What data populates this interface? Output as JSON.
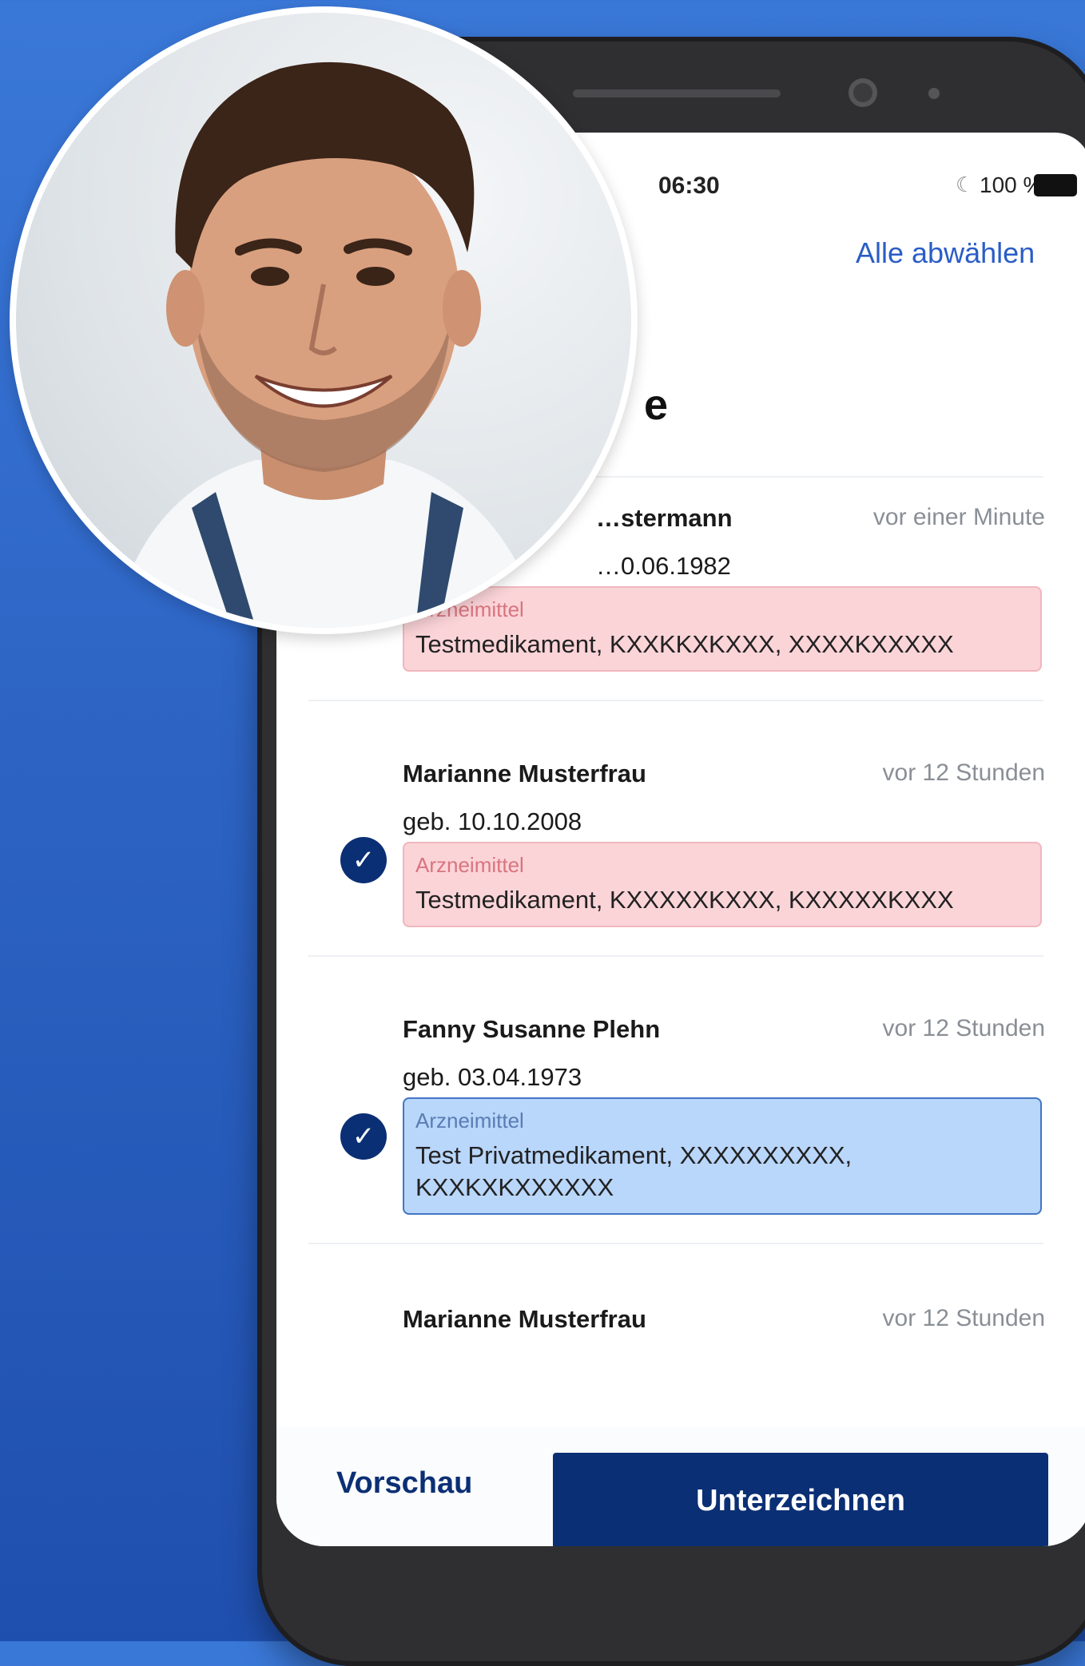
{
  "status": {
    "time": "06:30",
    "battery": "100 %"
  },
  "header": {
    "deselect_all": "Alle abwählen",
    "title_fragment": "e"
  },
  "items": [
    {
      "name": "…stermann",
      "time_ago": "vor einer Minute",
      "birth": "…0.06.1982",
      "med_label": "Arzneimittel",
      "med_value": "Testmedikament, KXXKKXKXXX, XXXXKXXXXX",
      "type": "red",
      "checked": true
    },
    {
      "name": "Marianne Musterfrau",
      "time_ago": "vor 12 Stunden",
      "birth": "geb. 10.10.2008",
      "med_label": "Arzneimittel",
      "med_value": "Testmedikament, KXXXXXKXXX, KXXXXXKXXX",
      "type": "red",
      "checked": true
    },
    {
      "name": "Fanny Susanne Plehn",
      "time_ago": "vor 12 Stunden",
      "birth": "geb. 03.04.1973",
      "med_label": "Arzneimittel",
      "med_value": "Test Privatmedikament, XXXXXXXXXX, KXXKXKXXXXXX",
      "type": "blue",
      "checked": true
    },
    {
      "name": "Marianne Musterfrau",
      "time_ago": "vor 12 Stunden"
    }
  ],
  "actions": {
    "preview": "Vorschau",
    "sign": "Unterzeichnen"
  },
  "icons": {
    "check": "check-icon",
    "battery": "battery-icon",
    "moon": "moon-icon"
  },
  "colors": {
    "navy": "#0b2f74",
    "link": "#2a5dc6",
    "red_box": "#fbd4d8",
    "blue_box": "#b9d6fb"
  }
}
